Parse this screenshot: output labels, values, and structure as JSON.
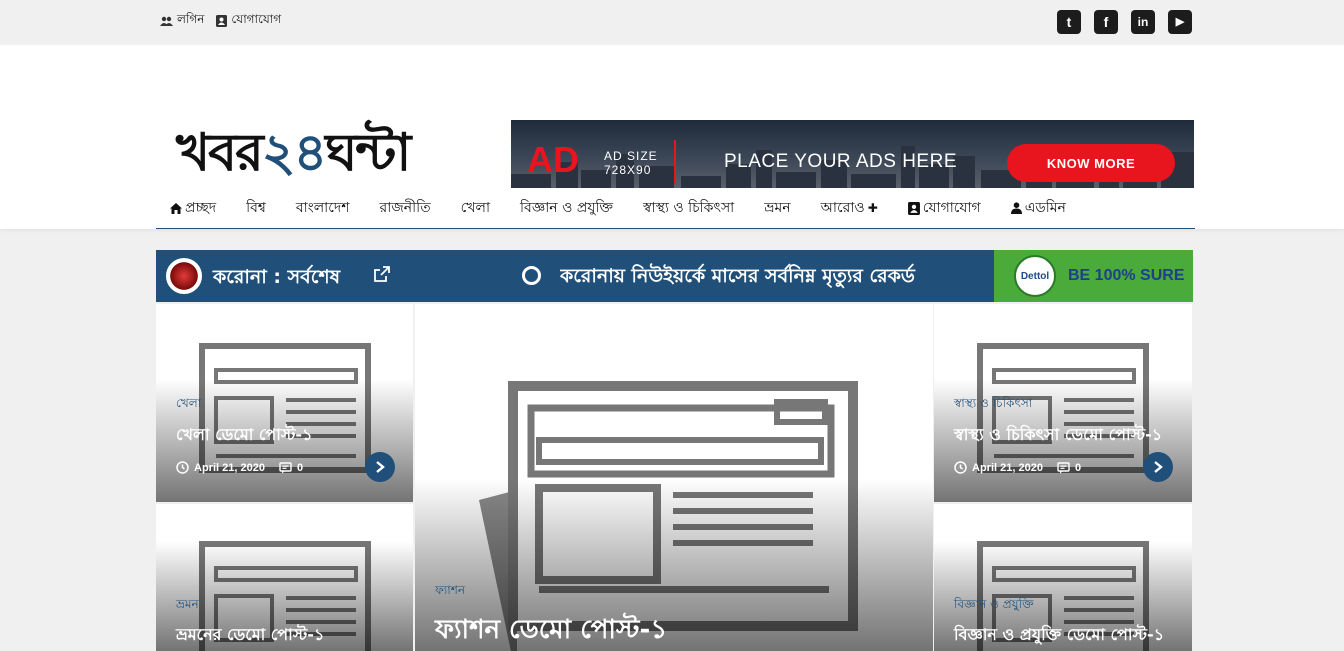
{
  "topbar": {
    "login_label": "লগিন",
    "contact_label": "যোগাযোগ",
    "social": [
      {
        "icon": "twitter-icon",
        "glyph": "t"
      },
      {
        "icon": "facebook-icon",
        "glyph": "f"
      },
      {
        "icon": "linkedin-icon",
        "glyph": "in"
      },
      {
        "icon": "youtube-icon",
        "glyph": "▶"
      }
    ]
  },
  "header": {
    "logo_part1": "খবর",
    "logo_num": "২৪",
    "logo_part2": "ঘন্টা",
    "ad": {
      "big": "AD",
      "size_line1": "AD SIZE",
      "size_line2": "728X90",
      "place_text": "PLACE YOUR ADS HERE",
      "button": "KNOW MORE"
    }
  },
  "nav": {
    "items": [
      {
        "label": "প্রচ্ছদ",
        "icon": "home-icon"
      },
      {
        "label": "বিশ্ব"
      },
      {
        "label": "বাংলাদেশ"
      },
      {
        "label": "রাজনীতি"
      },
      {
        "label": "খেলা"
      },
      {
        "label": "বিজ্ঞান ও প্রযুক্তি"
      },
      {
        "label": "স্বাস্থ্য ও চিকিৎসা"
      },
      {
        "label": "ভ্রমন"
      },
      {
        "label": "আরোও",
        "suffix": "✚"
      },
      {
        "label": "যোগাযোগ",
        "icon": "contact-icon"
      },
      {
        "label": "এডমিন",
        "icon": "user-icon"
      }
    ]
  },
  "ticker": {
    "label": "করোনা : সর্বশেষ",
    "headline": "করোনায় নিউইয়র্কে মাসের সর্বনিম্ন মৃত্যুর রেকর্ড",
    "dettol_logo": "Dettol",
    "dettol_text": "BE 100% SURE"
  },
  "cards": [
    {
      "category": "খেলা",
      "title": "খেলা ডেমো পোস্ট-১",
      "date": "April 21, 2020",
      "comments": "0"
    },
    {
      "category": "স্বাস্থ্য ও চিকিৎসা",
      "title": "স্বাস্থ্য ও চিকিৎসা ডেমো পোস্ট-১",
      "date": "April 21, 2020",
      "comments": "0"
    },
    {
      "category": "ভ্রমন",
      "title": "ভ্রমনের ডেমো পোস্ট-১"
    },
    {
      "category": "বিজ্ঞান ও প্রযুক্তি",
      "title": "বিজ্ঞান ও প্রযুক্তি ডেমো পোস্ট-১"
    },
    {
      "category": "ফ্যাশন",
      "title": "ফ্যাশন ডেমো পোস্ট-১"
    }
  ],
  "colors": {
    "accent": "#20507a",
    "ad_red": "#e8141e",
    "dettol_green": "#4aaa3a"
  }
}
